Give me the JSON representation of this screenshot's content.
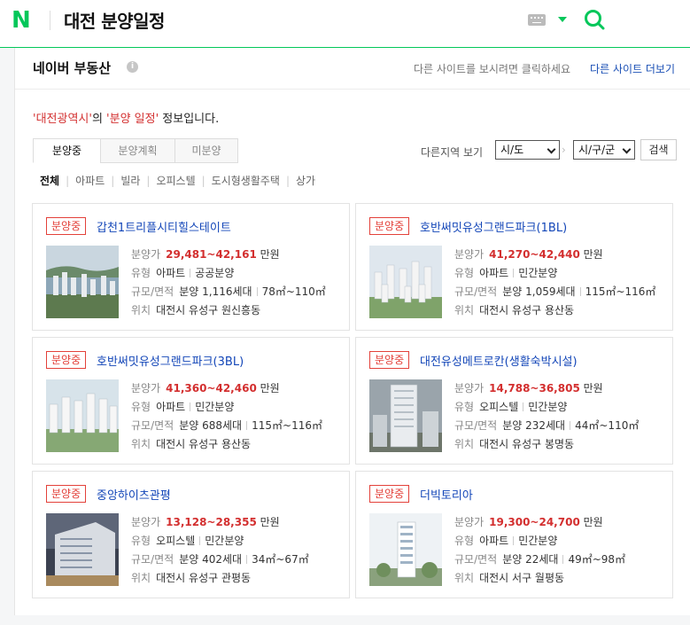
{
  "header": {
    "logo": "N",
    "query": "대전 분양일정",
    "icons": [
      "keyboard-icon",
      "chevron-down-icon",
      "search-icon"
    ]
  },
  "panel": {
    "title": "네이버 부동산",
    "info_icon": "i",
    "note": "다른 사이트를 보시려면 클릭하세요",
    "more_link": "다른 사이트 더보기"
  },
  "intro": {
    "region_quoted": "'대전광역시'",
    "mid": "의 ",
    "type_quoted": "'분양 일정'",
    "tail": " 정보입니다."
  },
  "tabs": [
    "분양중",
    "분양계획",
    "미분양"
  ],
  "region_select": {
    "label": "다른지역 보기",
    "sido": "시/도",
    "gugun": "시/구/군",
    "search_button": "검색"
  },
  "filters": [
    "전체",
    "아파트",
    "빌라",
    "오피스텔",
    "도시형생활주택",
    "상가"
  ],
  "labels": {
    "price": "분양가",
    "type": "유형",
    "scale": "규모/면적",
    "location": "위치",
    "unit": "만원"
  },
  "cards": [
    {
      "badge": "분양중",
      "title": "갑천1트리플시티힐스테이트",
      "price": "29,481~42,161",
      "type1": "아파트",
      "type2": "공공분양",
      "units": "분양 1,116세대",
      "area": "78㎡~110㎡",
      "location": "대전시 유성구 원신흥동"
    },
    {
      "badge": "분양중",
      "title": "호반써밋유성그랜드파크(1BL)",
      "price": "41,270~42,440",
      "type1": "아파트",
      "type2": "민간분양",
      "units": "분양 1,059세대",
      "area": "115㎡~116㎡",
      "location": "대전시 유성구 용산동"
    },
    {
      "badge": "분양중",
      "title": "호반써밋유성그랜드파크(3BL)",
      "price": "41,360~42,460",
      "type1": "아파트",
      "type2": "민간분양",
      "units": "분양 688세대",
      "area": "115㎡~116㎡",
      "location": "대전시 유성구 용산동"
    },
    {
      "badge": "분양중",
      "title": "대전유성메트로칸(생활숙박시설)",
      "price": "14,788~36,805",
      "type1": "오피스텔",
      "type2": "민간분양",
      "units": "분양 232세대",
      "area": "44㎡~110㎡",
      "location": "대전시 유성구 봉명동"
    },
    {
      "badge": "분양중",
      "title": "중앙하이츠관평",
      "price": "13,128~28,355",
      "type1": "오피스텔",
      "type2": "민간분양",
      "units": "분양 402세대",
      "area": "34㎡~67㎡",
      "location": "대전시 유성구 관평동"
    },
    {
      "badge": "분양중",
      "title": "더빅토리아",
      "price": "19,300~24,700",
      "type1": "아파트",
      "type2": "민간분양",
      "units": "분양 22세대",
      "area": "49㎡~98㎡",
      "location": "대전시 서구 월평동"
    }
  ]
}
